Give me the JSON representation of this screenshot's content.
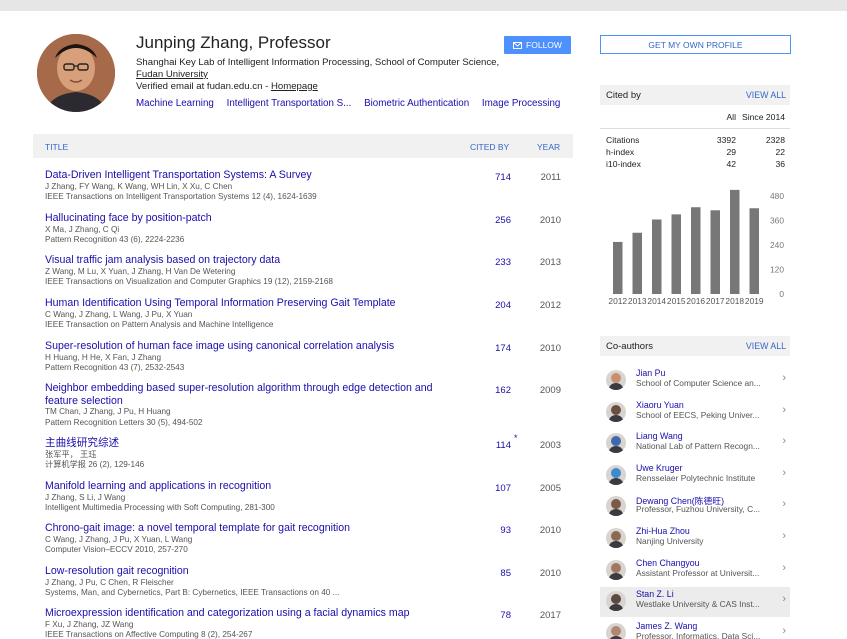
{
  "profile": {
    "name": "Junping Zhang, Professor",
    "affiliation_line1": "Shanghai Key Lab of Intelligent Information Processing, School of Computer Science,",
    "affiliation_line2": "Fudan University",
    "email_text": "Verified email at fudan.edu.cn - ",
    "homepage_label": "Homepage",
    "interests": [
      "Machine Learning",
      "Intelligent Transportation S...",
      "Biometric Authentication",
      "Image Processing"
    ],
    "follow_label": "FOLLOW",
    "get_profile_label": "GET MY OWN PROFILE"
  },
  "articles": {
    "headers": {
      "title": "TITLE",
      "cited_by": "CITED BY",
      "year": "YEAR"
    },
    "rows": [
      {
        "title": "Data-Driven Intelligent Transportation Systems: A Survey",
        "authors": "J Zhang, FY Wang, K Wang, WH Lin, X Xu, C Chen",
        "venue": "IEEE Transactions on Intelligent Transportation Systems 12 (4), 1624-1639",
        "cited": "714",
        "star": "",
        "year": "2011"
      },
      {
        "title": "Hallucinating face by position-patch",
        "authors": "X Ma, J Zhang, C Qi",
        "venue": "Pattern Recognition 43 (6), 2224-2236",
        "cited": "256",
        "star": "",
        "year": "2010"
      },
      {
        "title": "Visual traffic jam analysis based on trajectory data",
        "authors": "Z Wang, M Lu, X Yuan, J Zhang, H Van De Wetering",
        "venue": "IEEE Transactions on Visualization and Computer Graphics 19 (12), 2159-2168",
        "cited": "233",
        "star": "",
        "year": "2013"
      },
      {
        "title": "Human Identification Using Temporal Information Preserving Gait Template",
        "authors": "C Wang, J Zhang, L Wang, J Pu, X Yuan",
        "venue": "IEEE Transaction on Pattern Analysis and Machine Intelligence",
        "cited": "204",
        "star": "",
        "year": "2012"
      },
      {
        "title": "Super-resolution of human face image using canonical correlation analysis",
        "authors": "H Huang, H He, X Fan, J Zhang",
        "venue": "Pattern Recognition 43 (7), 2532-2543",
        "cited": "174",
        "star": "",
        "year": "2010"
      },
      {
        "title": "Neighbor embedding based super-resolution algorithm through edge detection and feature selection",
        "authors": "TM Chan, J Zhang, J Pu, H Huang",
        "venue": "Pattern Recognition Letters 30 (5), 494-502",
        "cited": "162",
        "star": "",
        "year": "2009"
      },
      {
        "title": "主曲线研究综述",
        "authors": "张军平， 王珏",
        "venue": "计算机学报 26 (2), 129-146",
        "cited": "114",
        "star": "*",
        "year": "2003"
      },
      {
        "title": "Manifold learning and applications in recognition",
        "authors": "J Zhang, S Li, J Wang",
        "venue": "Intelligent Multimedia Processing with Soft Computing, 281-300",
        "cited": "107",
        "star": "",
        "year": "2005"
      },
      {
        "title": "Chrono-gait image: a novel temporal template for gait recognition",
        "authors": "C Wang, J Zhang, J Pu, X Yuan, L Wang",
        "venue": "Computer Vision–ECCV 2010, 257-270",
        "cited": "93",
        "star": "",
        "year": "2010"
      },
      {
        "title": "Low-resolution gait recognition",
        "authors": "J Zhang, J Pu, C Chen, R Fleischer",
        "venue": "Systems, Man, and Cybernetics, Part B: Cybernetics, IEEE Transactions on 40 ...",
        "cited": "85",
        "star": "",
        "year": "2010"
      },
      {
        "title": "Microexpression identification and categorization using a facial dynamics map",
        "authors": "F Xu, J Zhang, JZ Wang",
        "venue": "IEEE Transactions on Affective Computing 8 (2), 254-267",
        "cited": "78",
        "star": "",
        "year": "2017"
      }
    ]
  },
  "cited_by": {
    "label": "Cited by",
    "view_all": "VIEW ALL",
    "col_all": "All",
    "col_since": "Since 2014",
    "stats": [
      {
        "name": "Citations",
        "all": "3392",
        "since": "2328"
      },
      {
        "name": "h-index",
        "all": "29",
        "since": "22"
      },
      {
        "name": "i10-index",
        "all": "42",
        "since": "36"
      }
    ]
  },
  "chart_data": {
    "type": "bar",
    "categories": [
      "2012",
      "2013",
      "2014",
      "2015",
      "2016",
      "2017",
      "2018",
      "2019"
    ],
    "values": [
      255,
      300,
      365,
      390,
      425,
      410,
      510,
      420
    ],
    "ylim": [
      0,
      480
    ],
    "yticks": [
      "0",
      "120",
      "240",
      "360",
      "480"
    ],
    "title": "",
    "xlabel": "",
    "ylabel": "",
    "bar_color": "#777777"
  },
  "coauthors": {
    "label": "Co-authors",
    "view_all": "VIEW ALL",
    "items": [
      {
        "name": "Jian Pu",
        "affil": "School of Computer Science an...",
        "color": "#c89070"
      },
      {
        "name": "Xiaoru Yuan",
        "affil": "School of EECS, Peking Univer...",
        "color": "#6a5040"
      },
      {
        "name": "Liang Wang",
        "affil": "National Lab of Pattern Recogn...",
        "color": "#3e68b0"
      },
      {
        "name": "Uwe Kruger",
        "affil": "Rensselaer Polytechnic Institute",
        "color": "#3a8ad0"
      },
      {
        "name": "Dewang Chen(陈德旺)",
        "affil": "Professor, Fuzhou University, C...",
        "color": "#7a5a48"
      },
      {
        "name": "Zhi-Hua Zhou",
        "affil": "Nanjing University",
        "color": "#8a6a50"
      },
      {
        "name": "Chen Changyou",
        "affil": "Assistant Professor at Universit...",
        "color": "#a07860"
      },
      {
        "name": "Stan Z. Li",
        "affil": "Westlake University & CAS Inst...",
        "color": "#5a4a40"
      },
      {
        "name": "James Z. Wang",
        "affil": "Professor, Informatics, Data Sci...",
        "color": "#b08870"
      }
    ],
    "highlighted_index": 7,
    "chevron": "›"
  }
}
